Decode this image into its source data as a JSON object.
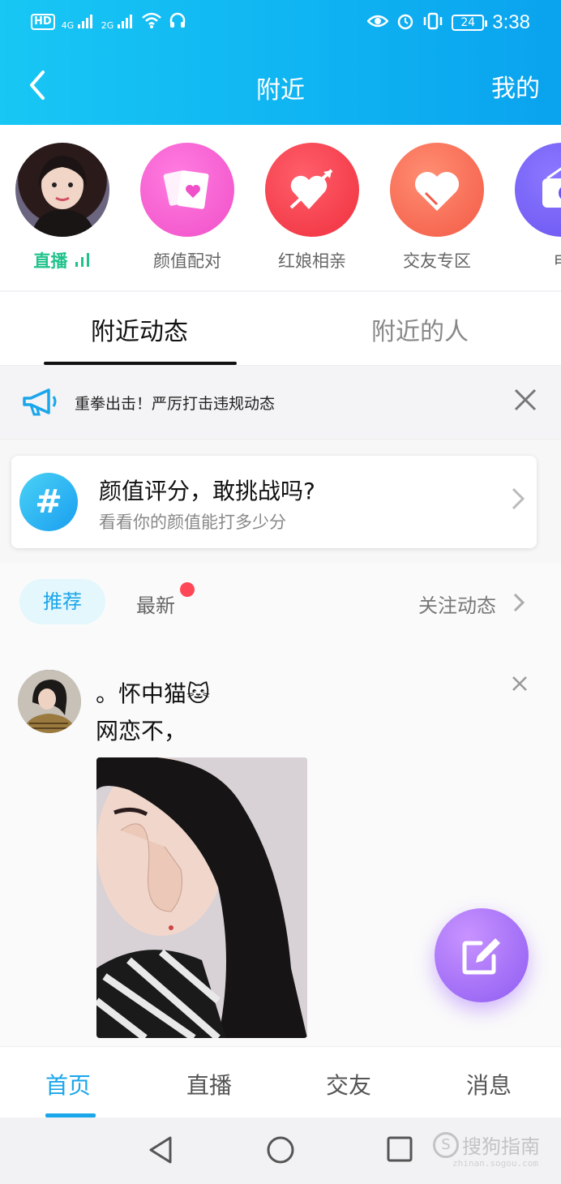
{
  "status_bar": {
    "left_badges": [
      "HD",
      "4G",
      "2G"
    ],
    "battery": "24",
    "time": "3:38"
  },
  "header": {
    "title": "附近",
    "right_link": "我的"
  },
  "categories": [
    {
      "label": "直播",
      "icon": "live-avatar"
    },
    {
      "label": "颜值配对",
      "icon": "cards-heart-icon"
    },
    {
      "label": "红娘相亲",
      "icon": "arrow-heart-icon"
    },
    {
      "label": "交友专区",
      "icon": "heart-icon"
    },
    {
      "label": "电",
      "icon": "radio-icon"
    }
  ],
  "tabs": {
    "active": "附近动态",
    "inactive": "附近的人"
  },
  "notice": {
    "text": "重拳出击！严厉打击违规动态"
  },
  "challenge_card": {
    "title": "颜值评分，敢挑战吗?",
    "subtitle": "看看你的颜值能打多少分",
    "icon_glyph": "#"
  },
  "feed_filter": {
    "recommend": "推荐",
    "latest": "最新",
    "follow": "关注动态"
  },
  "post": {
    "username": "。怀中猫",
    "emoji": "🐱",
    "text": "网恋不，"
  },
  "bottom_nav": [
    "首页",
    "直播",
    "交友",
    "消息"
  ],
  "watermark": {
    "brand": "搜狗指南",
    "url": "zhinan.sogou.com"
  },
  "colors": {
    "header_gradient_start": "#18c7f4",
    "header_gradient_end": "#0aa3ee",
    "accent": "#1aa6ea",
    "live_green": "#1fc28a",
    "red_dot": "#ff4757"
  }
}
